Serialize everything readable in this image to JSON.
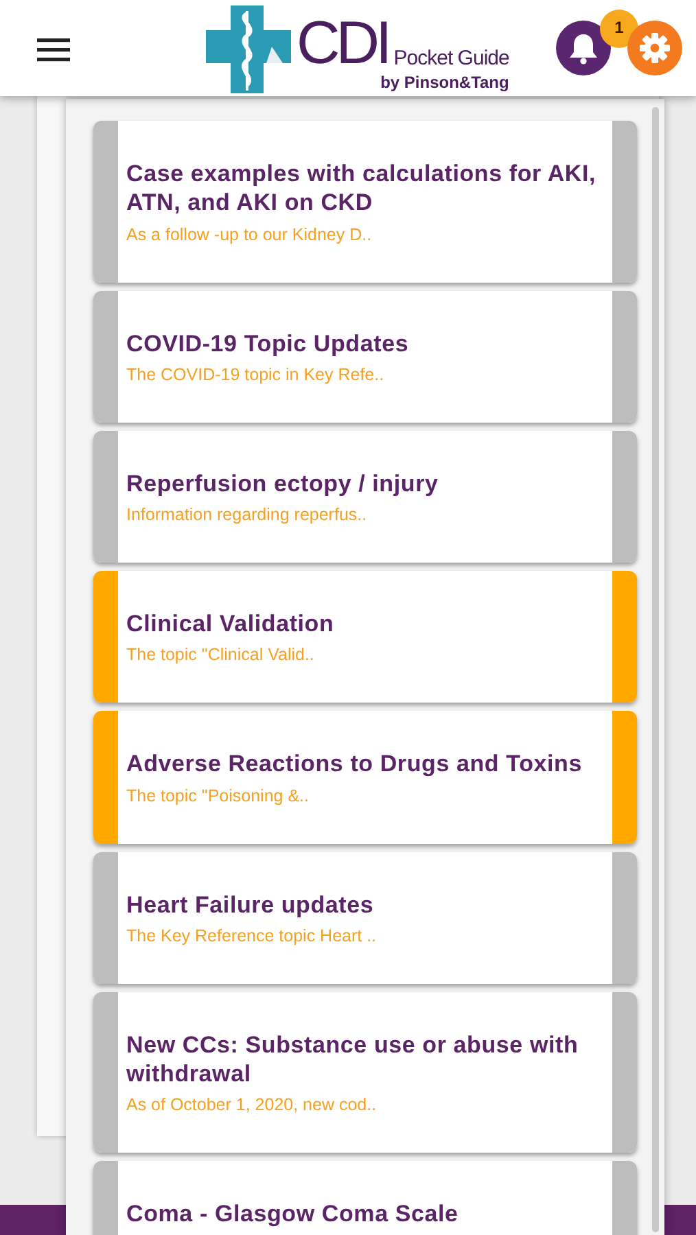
{
  "header": {
    "logo": {
      "main": "CDI",
      "tagline": "Pocket Guide",
      "byline": "by Pinson&Tang"
    },
    "notification_count": "1"
  },
  "updates": [
    {
      "title": "Case examples with calculations for AKI, ATN, and AKI on CKD",
      "snippet": "As a follow -up to our Kidney D..",
      "highlighted": false
    },
    {
      "title": "COVID-19 Topic Updates",
      "snippet": "The COVID-19 topic in Key Refe..",
      "highlighted": false
    },
    {
      "title": "Reperfusion ectopy / injury",
      "snippet": "Information regarding reperfus..",
      "highlighted": false
    },
    {
      "title": "Clinical Validation",
      "snippet": "The topic \"Clinical Valid..",
      "highlighted": true
    },
    {
      "title": "Adverse Reactions to Drugs and Toxins",
      "snippet": "The topic \"Poisoning &..",
      "highlighted": true
    },
    {
      "title": "Heart Failure updates",
      "snippet": "The Key Reference topic Heart ..",
      "highlighted": false
    },
    {
      "title": "New CCs: Substance use or abuse with withdrawal",
      "snippet": "As of October 1, 2020, new  cod..",
      "highlighted": false
    },
    {
      "title": "Coma - Glasgow Coma Scale",
      "highlighted": false
    }
  ]
}
